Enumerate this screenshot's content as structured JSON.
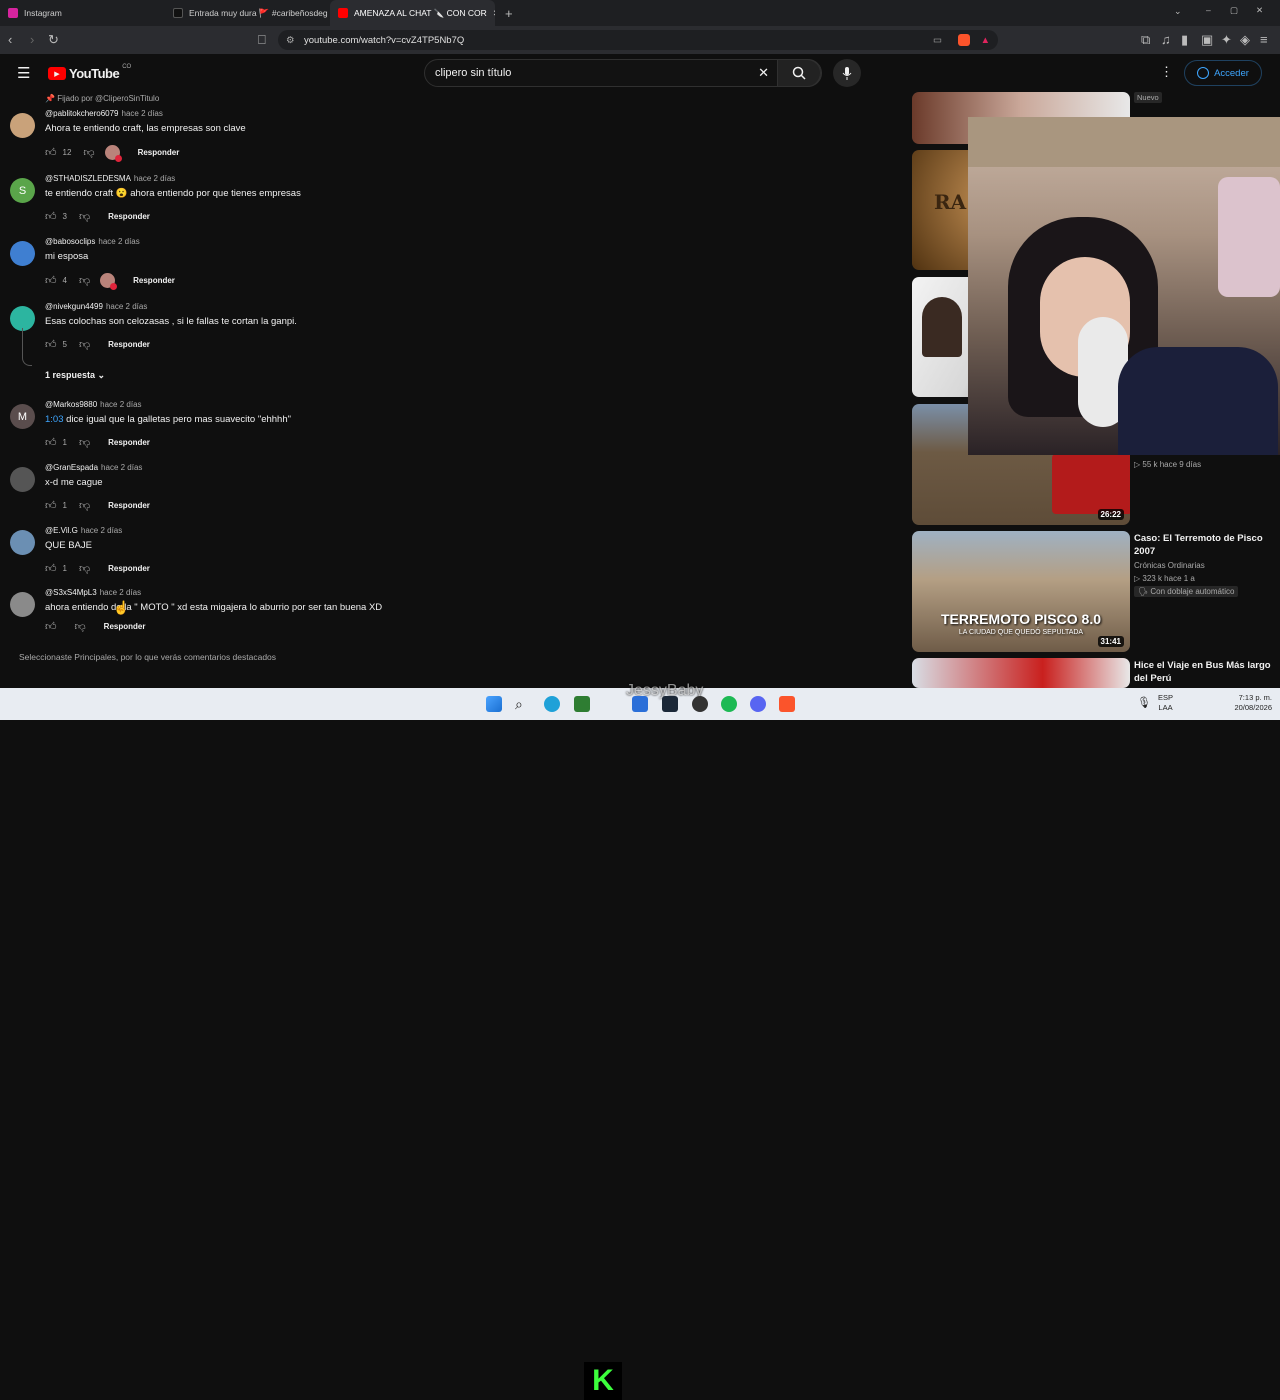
{
  "browser": {
    "tabs": [
      {
        "label": "Instagram",
        "color": "#d6249f"
      },
      {
        "label": "Entrada muy dura 🚩 #caribeñosdeg",
        "color": "#111111"
      },
      {
        "label": "AMENAZA AL CHAT 🔪 CON COR",
        "color": "#ff0000"
      }
    ],
    "url": "youtube.com/watch?v=cvZ4TP5Nb7Q"
  },
  "youtube": {
    "logo": "YouTube",
    "region": "CO",
    "search_value": "clipero sin título",
    "signin": "Acceder"
  },
  "comments": {
    "pinned": "Fijado por @CliperoSinTitulo",
    "items": [
      {
        "handle": "@pablitokchero6079",
        "time": "hace 2 días",
        "text": "Ahora te entiendo craft, las empresas son clave",
        "likes": "12",
        "reply": "Responder",
        "avatar_color": "#c9a27a",
        "initial": "",
        "creator_heart": true
      },
      {
        "handle": "@STHADISZLEDESMA",
        "time": "hace 2 días",
        "text": "te entiendo craft 😮 ahora entiendo por que tienes empresas",
        "likes": "3",
        "reply": "Responder",
        "avatar_color": "#5aa54a",
        "initial": "S",
        "creator_heart": false
      },
      {
        "handle": "@babosoclips",
        "time": "hace 2 días",
        "text": "mi esposa",
        "likes": "4",
        "reply": "Responder",
        "avatar_color": "#3f7fd1",
        "initial": "",
        "creator_heart": true
      },
      {
        "handle": "@nivekgun4499",
        "time": "hace 2 días",
        "text": "Esas colochas son celozasas , si le fallas te cortan la ganpi.",
        "likes": "5",
        "reply": "Responder",
        "avatar_color": "#2cb5a0",
        "initial": "",
        "creator_heart": false
      },
      {
        "handle": "@Markos9880",
        "time": "hace 2 días",
        "timestamp": "1:03",
        "text": " dice igual que la galletas pero mas suavecito \"ehhhh\"",
        "likes": "1",
        "reply": "Responder",
        "avatar_color": "#5a4d4d",
        "initial": "M",
        "creator_heart": false
      },
      {
        "handle": "@GranEspada",
        "time": "hace 2 días",
        "text": "x-d  me cague",
        "likes": "1",
        "reply": "Responder",
        "avatar_color": "#555555",
        "initial": "",
        "creator_heart": false
      },
      {
        "handle": "@E.Vil.G",
        "time": "hace 2 días",
        "text": "QUE BAJE",
        "likes": "1",
        "reply": "Responder",
        "avatar_color": "#6b8fb3",
        "initial": "",
        "creator_heart": false
      },
      {
        "handle": "@S3xS4MpL3",
        "time": "hace 2 días",
        "text": "ahora entiendo  de la \" MOTO \" xd esta migajera lo aburrio por ser tan buena XD",
        "likes": "",
        "reply": "Responder",
        "avatar_color": "#8a8a8a",
        "initial": "",
        "creator_heart": false
      }
    ],
    "replies_toggle": "1 respuesta",
    "footer": "Seleccionaste Principales, por lo que verás comentarios destacados"
  },
  "sidebar": {
    "badge_new": "Nuevo",
    "videos": [
      {
        "meta": "▷ 55 k   hace 9 días",
        "duration": "26:22"
      },
      {
        "title": "Caso: El Terremoto de Pisco 2007",
        "channel": "Crónicas Ordinarias",
        "meta": "▷ 323 k   hace 1 a",
        "dub": "Con doblaje automático",
        "duration": "31:41",
        "thumb_text": "TERREMOTO PISCO 8.0",
        "thumb_sub": "LA CIUDAD QUE QUEDÓ SEPULTADA"
      },
      {
        "title": "Hice el Viaje en Bus Más largo del Perú"
      }
    ]
  },
  "overlay": {
    "watermark": "JessyBaby"
  },
  "taskbar": {
    "lang": "ESP",
    "lang2": "LAA",
    "time": "7:13 p. m.",
    "date": "20/08/2026"
  }
}
